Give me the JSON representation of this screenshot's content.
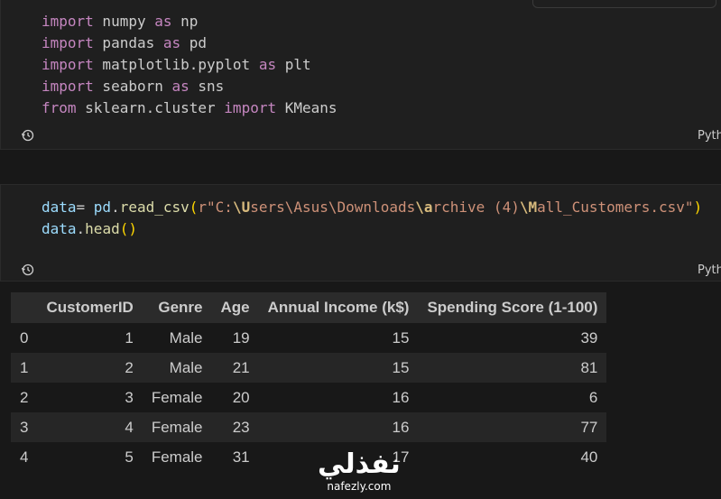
{
  "cells": [
    {
      "lines": [
        "import numpy as np",
        "import pandas as pd",
        "import matplotlib.pyplot as plt",
        "import seaborn as sns",
        "from sklearn.cluster import KMeans"
      ],
      "language": "Pyth"
    },
    {
      "lines": [
        "data= pd.read_csv(r\"C:\\Users\\Asus\\Downloads\\archive (4)\\Mall_Customers.csv\")",
        "data.head()"
      ],
      "language": "Pyth"
    }
  ],
  "output_table": {
    "columns": [
      "",
      "CustomerID",
      "Genre",
      "Age",
      "Annual Income (k$)",
      "Spending Score (1-100)"
    ],
    "rows": [
      [
        "0",
        "1",
        "Male",
        "19",
        "15",
        "39"
      ],
      [
        "1",
        "2",
        "Male",
        "21",
        "15",
        "81"
      ],
      [
        "2",
        "3",
        "Female",
        "20",
        "16",
        "6"
      ],
      [
        "3",
        "4",
        "Female",
        "23",
        "16",
        "77"
      ],
      [
        "4",
        "5",
        "Female",
        "31",
        "17",
        "40"
      ]
    ]
  },
  "watermark": {
    "logo": "نفذلي",
    "url": "nafezly.com"
  },
  "colors": {
    "background": "#181818",
    "cell": "#1f1f1f",
    "keyword": "#c586c0",
    "function": "#dcdcaa",
    "string": "#ce9178"
  }
}
